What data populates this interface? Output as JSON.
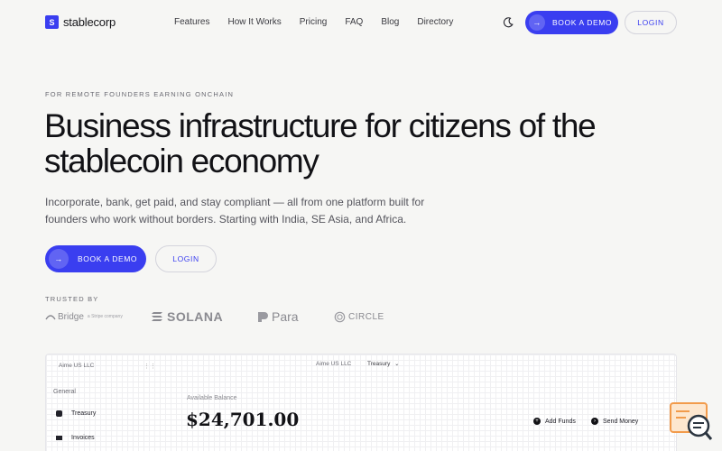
{
  "brand": {
    "logo_letter": "S",
    "name": "stablecorp"
  },
  "nav": {
    "links": [
      "Features",
      "How It Works",
      "Pricing",
      "FAQ",
      "Blog",
      "Directory"
    ],
    "book_demo": "BOOK A DEMO",
    "login": "LOGIN"
  },
  "hero": {
    "eyebrow": "FOR REMOTE FOUNDERS EARNING ONCHAIN",
    "headline": "Business infrastructure for citizens of the stablecoin economy",
    "subtext": "Incorporate, bank, get paid, and stay compliant — all from one platform built for founders who work without borders. Starting with India, SE Asia, and Africa.",
    "book_demo": "BOOK A DEMO",
    "login": "LOGIN"
  },
  "trusted": {
    "label": "TRUSTED BY",
    "partners": [
      {
        "name": "Bridge",
        "sub": "a Stripe company"
      },
      {
        "name": "SOLANA"
      },
      {
        "name": "Para"
      },
      {
        "name": "CIRCLE"
      }
    ]
  },
  "preview": {
    "company": "Aime US LLC",
    "section": "General",
    "items": [
      "Treasury",
      "Invoices"
    ],
    "top_company": "Aime US LLC",
    "top_menu": "Treasury",
    "balance_label": "Available Balance",
    "balance": "$24,701.00",
    "actions": [
      "Add Funds",
      "Send Money"
    ]
  },
  "colors": {
    "accent": "#3a3ef0",
    "background": "#f6f6f4",
    "help_widget": "#f29b4b"
  }
}
